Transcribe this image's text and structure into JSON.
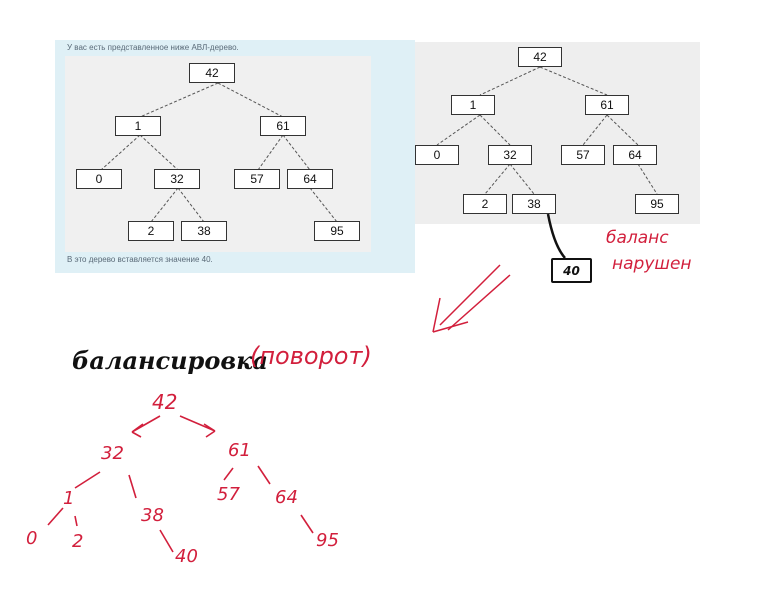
{
  "left_panel": {
    "caption_top": "У вас есть представленное ниже АВЛ-дерево.",
    "caption_bottom": "В это дерево вставляется значение 40.",
    "nodes": {
      "n42": "42",
      "n1": "1",
      "n61": "61",
      "n0": "0",
      "n32": "32",
      "n57": "57",
      "n64": "64",
      "n2": "2",
      "n38": "38",
      "n95": "95"
    }
  },
  "right_panel": {
    "nodes": {
      "n42": "42",
      "n1": "1",
      "n61": "61",
      "n0": "0",
      "n32": "32",
      "n57": "57",
      "n64": "64",
      "n2": "2",
      "n38": "38",
      "n95": "95"
    },
    "inserted": "40"
  },
  "annotations": {
    "balance_line1": "баланс",
    "balance_line2": "нарушен",
    "balancing_title": "балансировка",
    "rotation_note": "(поворот)"
  },
  "balanced_tree": {
    "n42": "42",
    "n32": "32",
    "n61": "61",
    "n1": "1",
    "n38": "38",
    "n57": "57",
    "n64": "64",
    "n0": "0",
    "n2": "2",
    "n40": "40",
    "n95": "95"
  },
  "colors": {
    "annotation_red": "#d21f3c",
    "left_panel_bg": "#dff0f6",
    "right_panel_bg": "#eeeeee"
  }
}
